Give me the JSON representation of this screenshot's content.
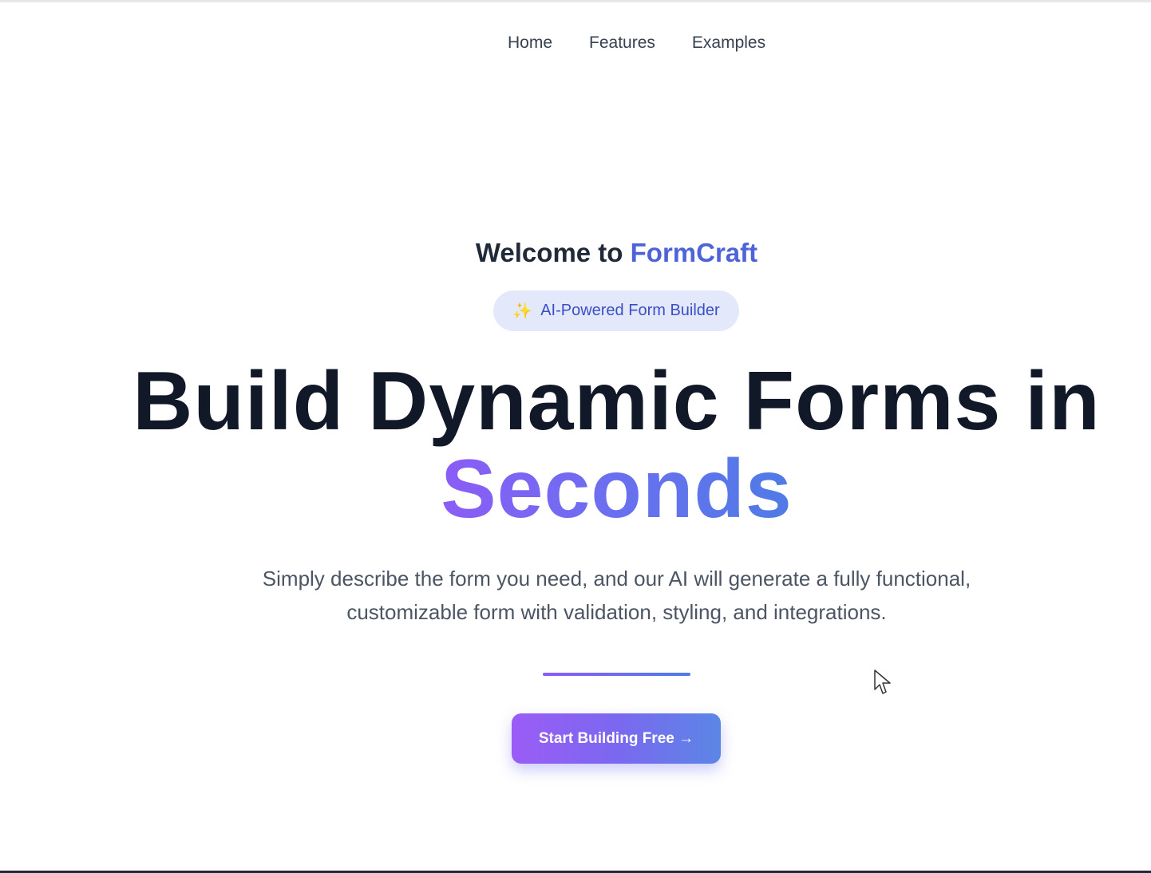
{
  "nav": {
    "items": [
      {
        "label": "Home"
      },
      {
        "label": "Features"
      },
      {
        "label": "Examples"
      }
    ]
  },
  "hero": {
    "welcome_prefix": "Welcome to ",
    "brand_name": "FormCraft",
    "badge_icon": "sparkle-icon",
    "badge_label": "AI-Powered Form Builder",
    "headline_line1": "Build Dynamic Forms in",
    "headline_accent": "Seconds",
    "description": "Simply describe the form you need, and our AI will generate a fully functional, customizable form with validation, styling, and integrations.",
    "cta_label": "Start Building Free →"
  },
  "colors": {
    "brand": "#4f63d8",
    "headline": "#111827",
    "accent_gradient_start": "#8b5cf6",
    "accent_gradient_end": "#4f7be6",
    "badge_bg": "#e3e9fb"
  }
}
